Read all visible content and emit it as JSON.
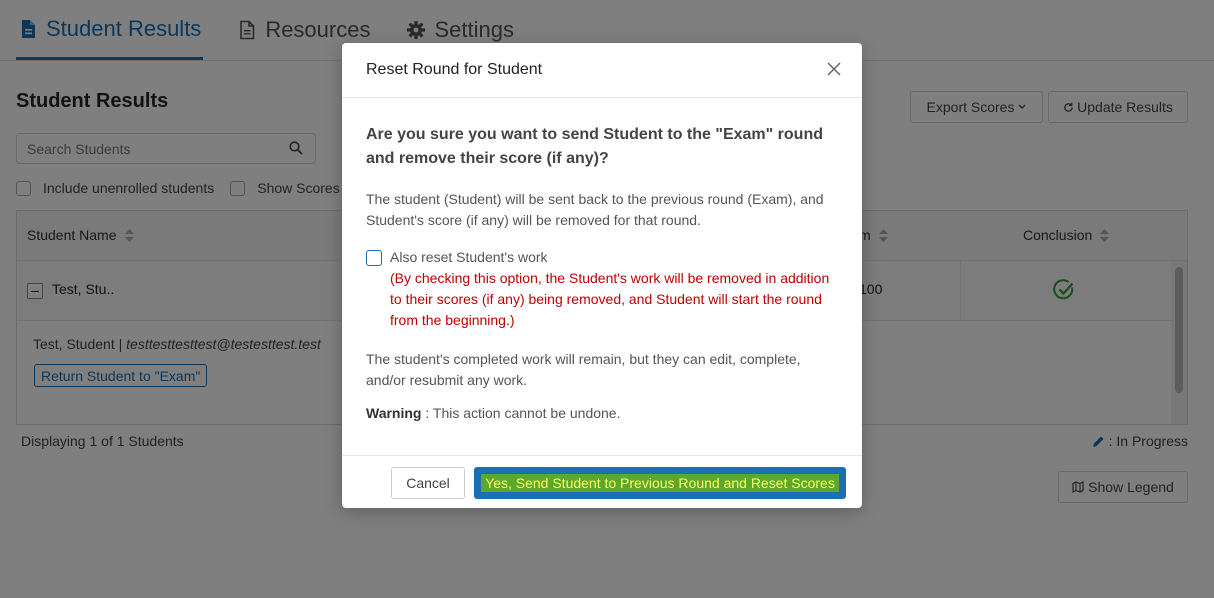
{
  "tabs": [
    {
      "label": "Student Results",
      "icon": "document-icon",
      "active": true
    },
    {
      "label": "Resources",
      "icon": "file-text-icon",
      "active": false
    },
    {
      "label": "Settings",
      "icon": "gear-icon",
      "active": false
    }
  ],
  "page": {
    "title": "Student Results",
    "search_placeholder": "Search Students",
    "include_unenrolled": "Include unenrolled students",
    "show_scores": "Show Scores",
    "export_label": "Export Scores",
    "update_label": "Update Results",
    "columns": {
      "name": "Student Name",
      "exam": "m",
      "conclusion": "Conclusion"
    },
    "row": {
      "name": "Test, Stu..",
      "score": "100"
    },
    "detail_name": "Test, Student |",
    "detail_email": "testtesttesttest@testesttest.test",
    "return_label": "Return Student to \"Exam\"",
    "displaying": "Displaying 1 of 1 Students",
    "status_key": ": In Progress",
    "legend_label": "Show Legend"
  },
  "modal": {
    "title": "Reset Round for Student",
    "question": "Are you sure you want to send Student to the \"Exam\" round and remove their score (if any)?",
    "explanation": "The student (Student) will be sent back to the previous round (Exam), and Student's score (if any) will be removed for that round.",
    "option_label": "Also reset Student's work",
    "option_warning": "(By checking this option, the Student's work will be removed in addition to their scores (if any) being removed, and Student will start the round from the beginning.)",
    "completed_note": "The student's completed work will remain, but they can edit, complete, and/or resubmit any work.",
    "warning_bold": "Warning",
    "warning_text": " : This action cannot be undone.",
    "cancel_label": "Cancel",
    "confirm_label": "Yes, Send Student to Previous Round and Reset Scores"
  },
  "colors": {
    "accent": "#1b6fb3",
    "warning": "#c00000",
    "success": "#2e9d3a"
  }
}
